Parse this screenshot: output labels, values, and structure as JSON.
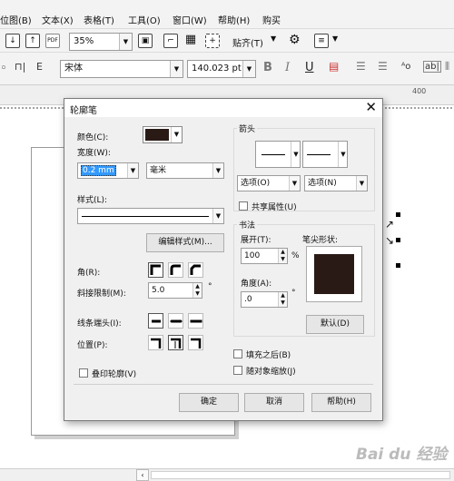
{
  "menu": {
    "items": [
      "位图(B)",
      "文本(X)",
      "表格(T)",
      "工具(O)",
      "窗口(W)",
      "帮助(H)",
      "购买"
    ]
  },
  "toolbar": {
    "zoom": "35%",
    "align_label": "贴齐(T)",
    "font_name": "宋体",
    "font_size": "140.023 pt",
    "bold": "B",
    "italic": "I",
    "underline": "U",
    "icons": [
      "import-icon",
      "export-icon",
      "pdf-icon",
      "fullscreen-icon",
      "rulers-icon",
      "grid-icon",
      "guidelines-icon",
      "options-gear-icon",
      "page-layout-icon",
      "text-align-icon",
      "list-icon"
    ]
  },
  "ruler": {
    "label": "400"
  },
  "watermark": "Bai du 经验",
  "dialog": {
    "title": "轮廓笔",
    "color_label": "颜色(C):",
    "color_value": "#2a1a16",
    "width_label": "宽度(W):",
    "width_value": "0.2 mm",
    "unit_value": "毫米",
    "style_label": "样式(L):",
    "edit_style_btn": "编辑样式(M)...",
    "corner_label": "角(R):",
    "miter_label": "斜接限制(M):",
    "miter_value": "5.0",
    "degree": "°",
    "cap_label": "线条端头(I):",
    "position_label": "位置(P):",
    "overprint_label": "叠印轮廓(V)",
    "arrows_title": "箭头",
    "options_left": "选项(O)",
    "options_right": "选项(N)",
    "share_attr": "共享属性(U)",
    "calligraphy_title": "书法",
    "stretch_label": "展开(T):",
    "stretch_value": "100",
    "percent": "%",
    "nib_label": "笔尖形状:",
    "angle_label": "角度(A):",
    "angle_value": ".0",
    "default_btn": "默认(D)",
    "fill_behind": "填充之后(B)",
    "scale_with_image": "随对象缩放(J)",
    "ok": "确定",
    "cancel": "取消",
    "help": "帮助(H)"
  }
}
